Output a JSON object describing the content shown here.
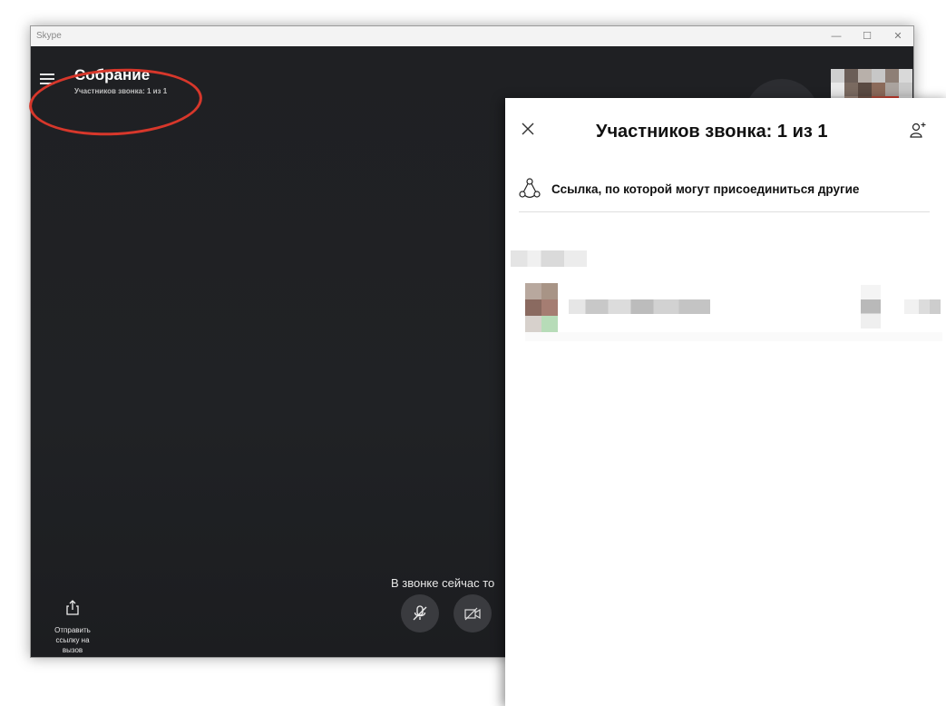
{
  "window": {
    "title": "Skype",
    "controls": [
      "—",
      "☐",
      "✕"
    ]
  },
  "call": {
    "meeting_title": "Собрание",
    "participants_count": "Участников звонка: 1 из 1",
    "notice": "В звонке сейчас то",
    "share_link_label": "Отправить ссылку на вызов"
  },
  "panel": {
    "title": "Участников звонка: 1 из 1",
    "link_text": "Ссылка, по которой могут присоединиться другие"
  },
  "icons": {
    "hamburger": "hamburger-icon",
    "layout": "layout-icon",
    "add_person": "add-person-icon",
    "mic_off": "mic-off-icon",
    "video_off": "video-off-icon",
    "share": "share-icon",
    "close": "close-icon"
  },
  "colors": {
    "call_background": "#202124",
    "highlight": "#d7372b",
    "panel_background": "#ffffff"
  }
}
